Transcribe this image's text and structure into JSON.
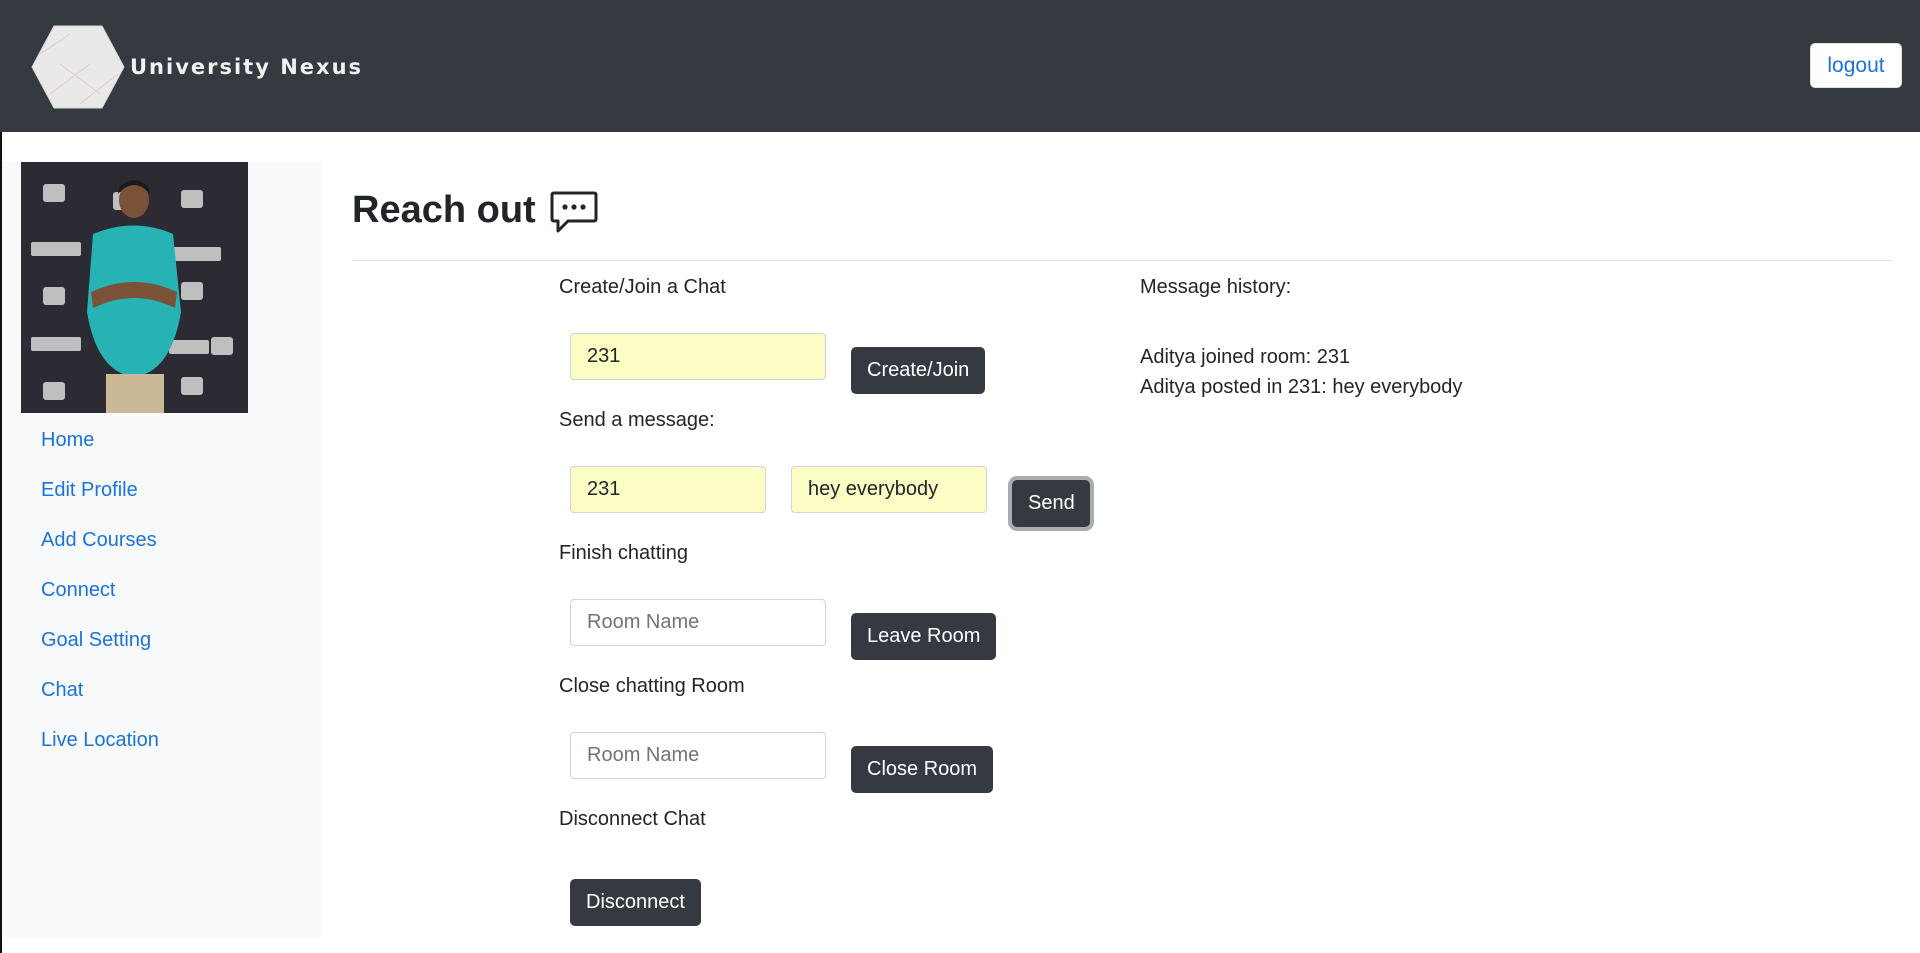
{
  "header": {
    "brand_name": "University Nexus",
    "logout_label": "logout",
    "colors": {
      "navbar_bg": "#343a40",
      "link": "#1a73d9"
    }
  },
  "sidebar": {
    "profile_photo": "user-profile-photo",
    "items": [
      {
        "label": "Home"
      },
      {
        "label": "Edit Profile"
      },
      {
        "label": "Add Courses"
      },
      {
        "label": "Connect"
      },
      {
        "label": "Goal Setting"
      },
      {
        "label": "Chat"
      },
      {
        "label": "Live Location"
      }
    ]
  },
  "page": {
    "title": "Reach out",
    "title_icon": "chat-bubble-icon"
  },
  "create_join": {
    "label": "Create/Join a Chat",
    "room_value": "231",
    "button_label": "Create/Join"
  },
  "send_message": {
    "label": "Send a message:",
    "room_value": "231",
    "message_value": "hey everybody",
    "button_label": "Send"
  },
  "leave": {
    "label": "Finish chatting",
    "placeholder": "Room Name",
    "button_label": "Leave Room"
  },
  "close": {
    "label": "Close chatting Room",
    "placeholder": "Room Name",
    "button_label": "Close Room"
  },
  "disconnect": {
    "label": "Disconnect Chat",
    "button_label": "Disconnect"
  },
  "history": {
    "label": "Message history:",
    "lines": [
      "Aditya joined room: 231",
      "Aditya posted in 231: hey everybody"
    ]
  }
}
